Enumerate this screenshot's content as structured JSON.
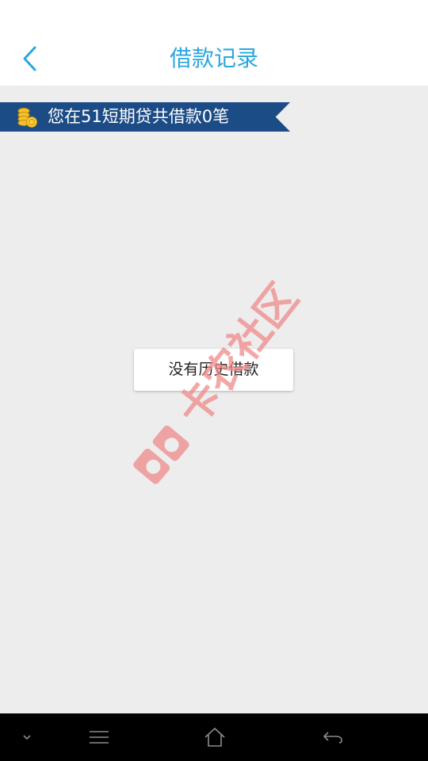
{
  "colors": {
    "accent": "#29a6e0",
    "ribbon": "#1c4c86",
    "watermark": "#f08a8a",
    "nav_icon": "#8c8c8c"
  },
  "header": {
    "title": "借款记录",
    "back_icon": "chevron-left-icon"
  },
  "ribbon": {
    "icon": "coin-stack-icon",
    "text": "您在51短期贷共借款0笔"
  },
  "empty_state": {
    "message": "没有历史借款"
  },
  "watermark": {
    "text": "卡农社区",
    "icon": "kanong-logo-icon"
  },
  "navbar": {
    "items": [
      {
        "name": "collapse",
        "icon": "chevron-down-icon"
      },
      {
        "name": "menu",
        "icon": "menu-icon"
      },
      {
        "name": "home",
        "icon": "home-icon"
      },
      {
        "name": "back",
        "icon": "back-arrow-icon"
      }
    ]
  }
}
